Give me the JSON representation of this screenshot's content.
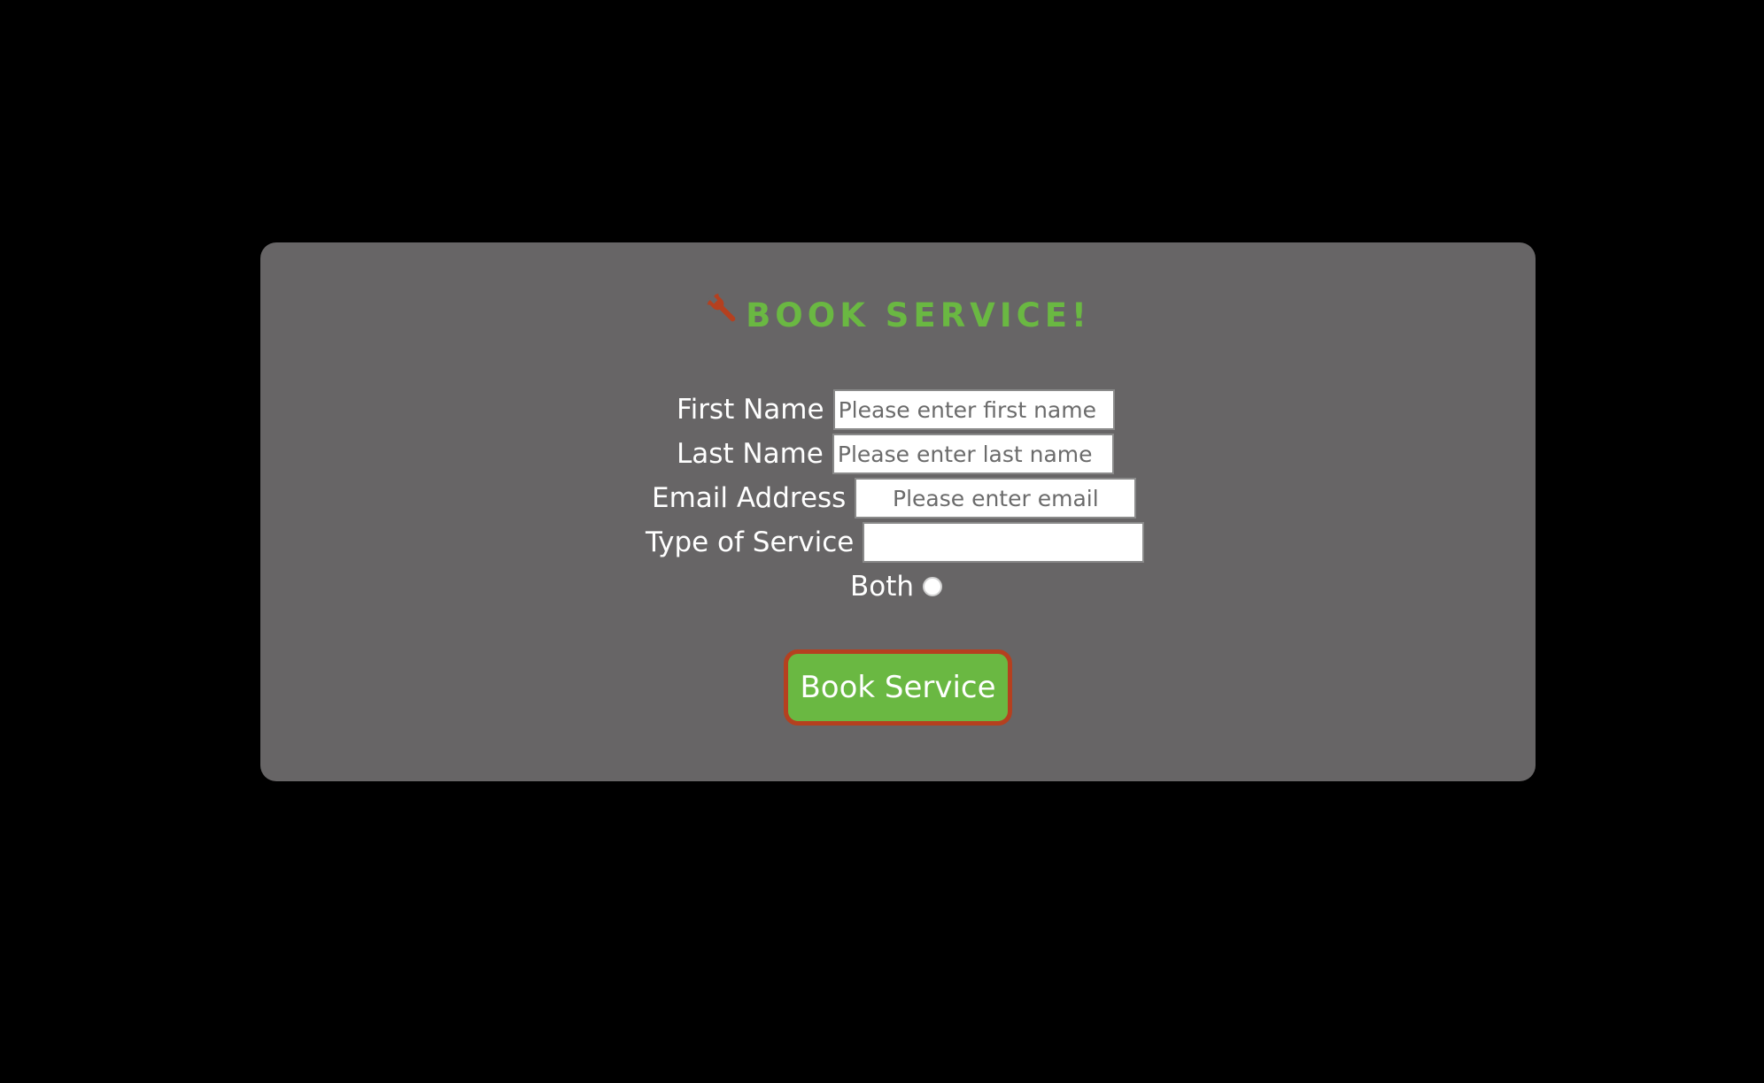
{
  "form": {
    "title": "BOOK SERVICE!",
    "icon": "wrench-icon",
    "colors": {
      "accent": "#6ab842",
      "icon": "#b5401f",
      "card": "#676566",
      "background": "#000000",
      "button_border": "#b5401f"
    },
    "fields": {
      "first_name": {
        "label": "First Name",
        "placeholder": "Please enter first name",
        "value": ""
      },
      "last_name": {
        "label": "Last Name",
        "placeholder": "Please enter last name",
        "value": ""
      },
      "email": {
        "label": "Email Address",
        "placeholder": "Please enter email",
        "value": ""
      },
      "service_type": {
        "label": "Type of Service",
        "placeholder": "",
        "value": ""
      }
    },
    "radio": {
      "label": "Both",
      "checked": false
    },
    "submit_label": "Book Service"
  }
}
